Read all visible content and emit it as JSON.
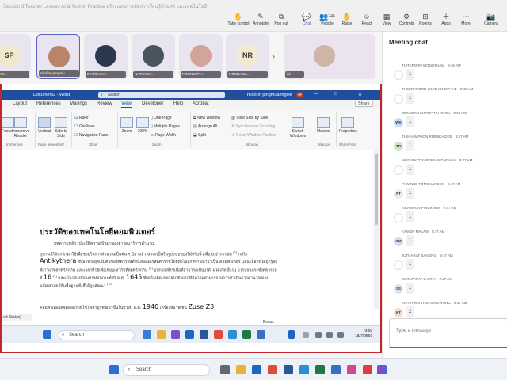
{
  "teams": {
    "meeting_title": "Session 3 Teacher Lesson: AI & Tech in Practice สร้างแผนการจัดการเรียนรู้ด้วย AI และเทคโนโลยี",
    "toolbar": [
      {
        "label": "Take control",
        "icon": "hand-icon"
      },
      {
        "label": "Annotate",
        "icon": "pen-icon"
      },
      {
        "label": "Pop out",
        "icon": "popout-icon"
      },
      {
        "label": "Chat",
        "icon": "chat-icon"
      },
      {
        "label": "People",
        "icon": "people-icon"
      },
      {
        "label": "Raise",
        "icon": "raise-hand-icon"
      },
      {
        "label": "React",
        "icon": "react-icon"
      },
      {
        "label": "View",
        "icon": "view-icon"
      },
      {
        "label": "Rooms",
        "icon": "rooms-icon"
      },
      {
        "label": "Apps",
        "icon": "apps-icon"
      },
      {
        "label": "More",
        "icon": "more-icon"
      },
      {
        "label": "Camera",
        "icon": "camera-icon"
      }
    ],
    "people_count": "246"
  },
  "participants": [
    {
      "initials": "SP",
      "name": "THIPHO...",
      "color": "#f2e8c9"
    },
    {
      "initials": "",
      "name": "niluбon pingmu...",
      "color": "#e9d9c8"
    },
    {
      "initials": "",
      "name": "IRATCHAY...",
      "color": "#2c3750"
    },
    {
      "initials": "",
      "name": "NATTAWA...",
      "color": "#48555e"
    },
    {
      "initials": "",
      "name": "PORNWIPH...",
      "color": "#d4a39a"
    },
    {
      "initials": "NR",
      "name": "NONNAWA...",
      "color": "#f5ead1"
    },
    {
      "initials": "",
      "name": "nil",
      "color": "#e1d6e2"
    }
  ],
  "word": {
    "doc_name": "Document2 - Word",
    "search_placeholder": "Search",
    "user_name": "niluбon pingmuaenglek",
    "user_initials": "NP",
    "tabs": [
      "Layout",
      "References",
      "Mailings",
      "Review",
      "View",
      "Developer",
      "Help",
      "Acrobat"
    ],
    "active_tab": "View",
    "share_label": "Share",
    "ribbon": {
      "read_mode": "Focus",
      "immersive_reader": "Immersive Reader",
      "vertical": "Vertical",
      "side_to_side": "Side to Side",
      "ruler": "Ruler",
      "gridlines": "Gridlines",
      "navigation_pane": "Navigation Pane",
      "zoom": "Zoom",
      "zoom_pct": "100%",
      "one_page": "One Page",
      "multiple_pages": "Multiple Pages",
      "page_width": "Page Width",
      "new_window": "New Window",
      "arrange_all": "Arrange All",
      "split": "Split",
      "view_side_by_side": "View Side by Side",
      "sync_scrolling": "Synchronous Scrolling",
      "reset_window": "Reset Window Position",
      "switch_windows": "Switch Windows",
      "macros": "Macros",
      "properties": "Properties",
      "groups": [
        "Immersive",
        "Page Movement",
        "Show",
        "Zoom",
        "Window",
        "Macros",
        "SharePoint"
      ]
    },
    "doc": {
      "heading": "ประวัติของเทคโนโลยีคอมพิวเตอร์",
      "sub": "บทความหลัก: ประวัติความเป็นมาของฮาร์ดแวร์การคำนวณ",
      "p1_a": "อุปกรณ์ได้ถูกนำมาใช้เพื่อช่วยในการคำนวณเป็นพัน ๆ ปีมาแล้ว น่าจะเป็นในรูปแบบของไม้หรือนิ้วเพื่อนับจำการนับ",
      "p1_ref1": "[7]",
      "p1_b": "กลไก",
      "p1_big": "Antikythera",
      "p1_c": "สืบมาจากยุคเริ่มต้นของศตวรรษที่หนึ่งก่อนคริสตศักราชโดยทั่วไปถูกพิจารณาว่าเป็น คอมพิวเตอร์ แอนะล็อกที่ได้ถูกรู้จักที่เก่าแก่ที่สุดที่รู้จักกัน และเวลาที่ใช้เพื่อเทียบเท่ากับที่สุดที่รู้จักกัน",
      "p1_ref2": "[8]",
      "p1_d": "อุปกรณ์ที่ใช้เพื่อที่สามารถเทียบได้ไม่ได้เกิดขึ้นใน ยุโรปจนกระทั่งศตวรรษที่",
      "p1_big2": "16",
      "p1_ref3": "[9]",
      "p1_e": "และเป็นได้เปลี่ยนแปลงจนกระทั่งปี ค.ศ.",
      "p1_big3": "1645",
      "p1_f": "ที่เครื่องคิดเลขกลไกตัวแรกที่มีความสามารถในการดำเนินการคำนวณทางคณิตศาสตร์ขั้นพื้นฐานทั้งสี่ได้ถูกพัฒนา",
      "p1_ref4": "[10]",
      "p2_a": "คอมพิวเตอร์ดิจิตอลแรกที่ใช้ไฟฟ้าถูกพัฒนาขึ้นในช่วงปี ค.ศ.",
      "p2_big": "1940",
      "p2_b": "เครื่องหมายเช่น",
      "p2_big2": "Zuse Z3,"
    },
    "status_left": "ed States)"
  },
  "inner_taskbar": {
    "search": "Search",
    "focus": "Focus",
    "time": "9:50",
    "date": "18/7/2569"
  },
  "chat": {
    "title": "Meeting chat",
    "messages": [
      {
        "name": "THITAPORN WONGTHAM",
        "time": "9:46 AM",
        "initials": "",
        "avatar_color": "#ffffff",
        "text": "1"
      },
      {
        "name": "THEERAPORN SKATHONGPHAE",
        "time": "9:46 AM",
        "initials": "",
        "avatar_color": "#ffffff",
        "text": "1"
      },
      {
        "name": "WIRAWAN KHAMPHATHONG",
        "time": "9:46 AM",
        "initials": "WK",
        "avatar_color": "#c6dcf5",
        "text": "1"
      },
      {
        "name": "THIKHAMPHON RUENKAIDEE",
        "time": "9:47 AM",
        "initials": "TR",
        "avatar_color": "#cfe3c8",
        "text": "1"
      },
      {
        "name": "MISS RATTIYAPORN WONGHAN",
        "time": "9:47 AM",
        "initials": "",
        "avatar_color": "#ffffff",
        "text": "1"
      },
      {
        "name": "PAWINEE TOMCHAROEN",
        "time": "9:47 AM",
        "initials": "PT",
        "avatar_color": "#ececec",
        "text": "1"
      },
      {
        "name": "TIKAMPON PINGKHAM",
        "time": "9:47 AM",
        "initials": "",
        "avatar_color": "#ffffff",
        "text": "1"
      },
      {
        "name": "KAMON MALAM",
        "time": "9:47 AM",
        "initials": "KM",
        "avatar_color": "#e0d4ef",
        "text": "1"
      },
      {
        "name": "JUTHARAT SANGNIL",
        "time": "9:47 AM",
        "initials": "",
        "avatar_color": "#ffffff",
        "text": "1"
      },
      {
        "name": "SURAPAPAT SAETIA",
        "time": "9:47 AM",
        "initials": "SS",
        "avatar_color": "#d6e6f2",
        "text": "1"
      },
      {
        "name": "KRITTANAI THEPSINGWONG",
        "time": "9:47 AM",
        "initials": "KT",
        "avatar_color": "#f2dccf",
        "text": "2"
      }
    ],
    "input_placeholder": "Type a message"
  },
  "outer_taskbar": {
    "search": "Search"
  },
  "colors": {
    "accent": "#5b5fc7",
    "word_blue": "#1e4e9d",
    "share_border": "#c4262e"
  }
}
